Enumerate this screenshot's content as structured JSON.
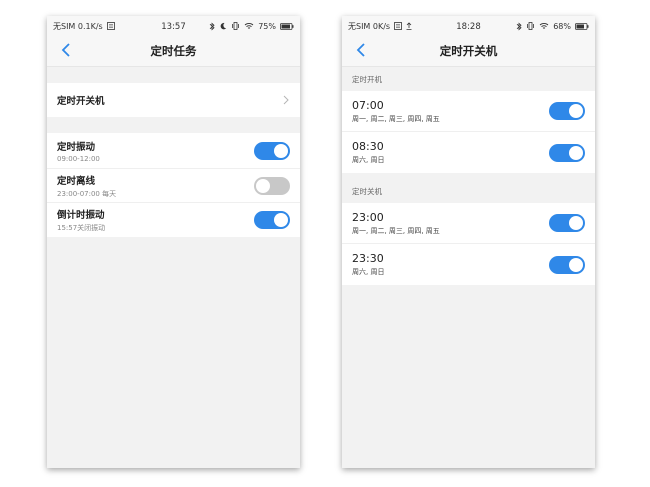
{
  "phoneA": {
    "status": {
      "carrier": "无SIM 0.1K/s",
      "time": "13:57",
      "battery": "75%"
    },
    "title": "定时任务",
    "item_schedule": "定时开关机",
    "items": [
      {
        "title": "定时振动",
        "sub": "09:00-12:00",
        "on": true
      },
      {
        "title": "定时离线",
        "sub": "23:00-07:00 每天",
        "on": false
      },
      {
        "title": "倒计时振动",
        "sub": "15:57关闭振动",
        "on": true
      }
    ]
  },
  "phoneB": {
    "status": {
      "carrier": "无SIM 0K/s",
      "time": "18:28",
      "battery": "68%"
    },
    "title": "定时开关机",
    "section_on": "定时开机",
    "section_off": "定时关机",
    "power_on": [
      {
        "time": "07:00",
        "days": "周一, 周二, 周三, 周四, 周五",
        "on": true
      },
      {
        "time": "08:30",
        "days": "周六, 周日",
        "on": true
      }
    ],
    "power_off": [
      {
        "time": "23:00",
        "days": "周一, 周二, 周三, 周四, 周五",
        "on": true
      },
      {
        "time": "23:30",
        "days": "周六, 周日",
        "on": true
      }
    ]
  },
  "colors": {
    "accent": "#2f88e8",
    "toggle_off": "#c8c8c8"
  },
  "icons": [
    "back-arrow-icon",
    "chevron-right-icon",
    "bluetooth-icon",
    "moon-icon",
    "vibrate-icon",
    "wifi-icon",
    "battery-icon",
    "sim-icon",
    "upload-icon"
  ]
}
